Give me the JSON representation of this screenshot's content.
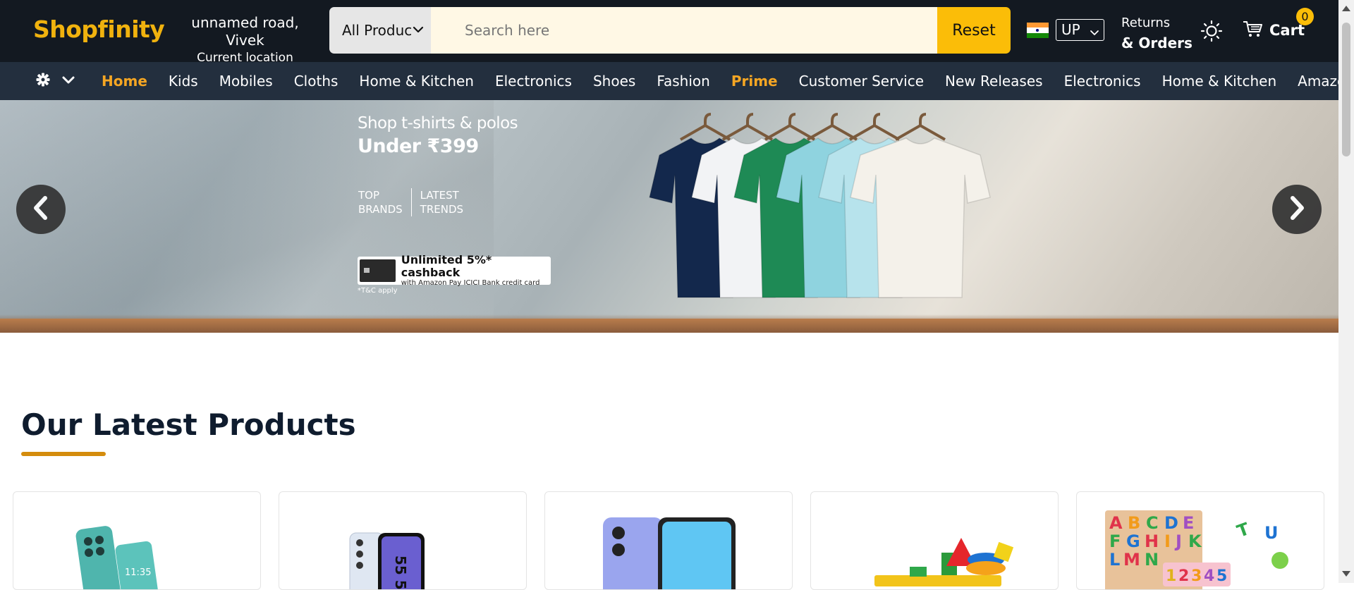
{
  "header": {
    "logo": "Shopfinity",
    "location_line1": "unnamed road, Vivek",
    "location_line2": "Current location",
    "search": {
      "category": "All Products",
      "placeholder": "Search here",
      "reset_label": "Reset"
    },
    "state": "UP",
    "returns_line1": "Returns",
    "returns_line2": "& Orders",
    "cart_label": "Cart",
    "cart_count": "0"
  },
  "nav": {
    "items": [
      {
        "label": "Home",
        "active": true
      },
      {
        "label": "Kids"
      },
      {
        "label": "Mobiles"
      },
      {
        "label": "Cloths"
      },
      {
        "label": "Home & Kitchen"
      },
      {
        "label": "Electronics"
      },
      {
        "label": "Shoes"
      },
      {
        "label": "Fashion"
      },
      {
        "label": "Prime",
        "highlight": true
      },
      {
        "label": "Customer Service"
      },
      {
        "label": "New Releases"
      },
      {
        "label": "Electronics"
      },
      {
        "label": "Home & Kitchen"
      },
      {
        "label": "Amazon Pay"
      }
    ]
  },
  "hero": {
    "line1": "Shop t-shirts & polos",
    "line2": "Under ₹399",
    "tag1_a": "TOP",
    "tag1_b": "BRANDS",
    "tag2_a": "LATEST",
    "tag2_b": "TRENDS",
    "cashback_title": "Unlimited 5%* cashback",
    "cashback_sub": "with Amazon Pay ICICI Bank credit card",
    "tnc": "*T&C apply",
    "shirt_colors": [
      "#13284c",
      "#f2f3f5",
      "#1e8a55",
      "#8fd3df",
      "#b7e3ec",
      "#f4f1ea"
    ]
  },
  "products": {
    "title": "Our Latest Products",
    "cards": [
      {
        "icon": "phone-teal-icon"
      },
      {
        "icon": "phone-5g-icon"
      },
      {
        "icon": "phone-blue-icon"
      },
      {
        "icon": "stacking-toy-icon"
      },
      {
        "icon": "alphabet-puzzle-icon"
      }
    ]
  },
  "colors": {
    "header_bg": "#131921",
    "nav_bg": "#232f3e",
    "accent": "#fbbd08",
    "logo": "#f0b20e",
    "active_nav": "#f5a623"
  }
}
